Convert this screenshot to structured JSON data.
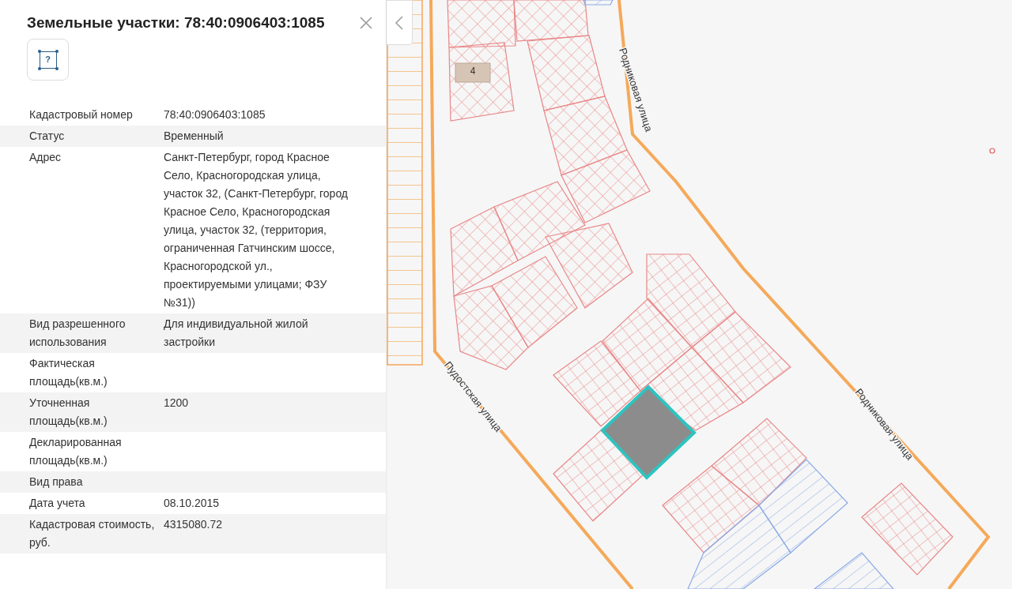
{
  "panel": {
    "title": "Земельные участки: 78:40:0906403:1085",
    "tool_glyph": "?",
    "rows": [
      {
        "label": "Кадастровый номер",
        "value": "78:40:0906403:1085"
      },
      {
        "label": "Статус",
        "value": "Временный"
      },
      {
        "label": "Адрес",
        "value": "Санкт-Петербург, город Красное Село, Красногородская улица, участок 32, (Санкт-Петербург, город Красное Село, Красногородская улица, участок 32, (территория, ограниченная Гатчинским шоссе, Красногородской ул., проектируемыми улицами; ФЗУ №31))"
      },
      {
        "label": "Вид разрешенного использования",
        "value": "Для индивидуальной жилой застройки"
      },
      {
        "label": "Фактическая площадь(кв.м.)"
      },
      {
        "label": "Уточненная площадь(кв.м.)",
        "value": "1200"
      },
      {
        "label": "Декларированная площадь(кв.м.)"
      },
      {
        "label": "Вид права"
      },
      {
        "label": "Дата учета",
        "value": "08.10.2015"
      },
      {
        "label": "Кадастровая стоимость, руб.",
        "value": "4315080.72"
      }
    ]
  },
  "map": {
    "parcel_number": "4",
    "streets": [
      "Родниковая улица",
      "Пудостская улица",
      "Родниковая улица"
    ]
  }
}
